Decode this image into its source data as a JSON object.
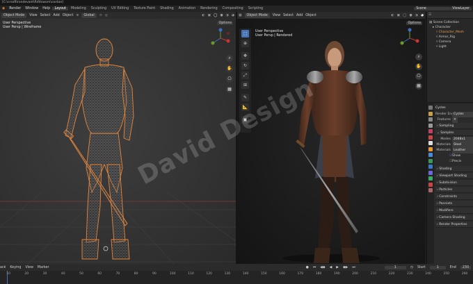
{
  "window": {
    "title": "[C:\\crsoft\\rondevant\\Rd\\tsworn\\contan]"
  },
  "menubar": {
    "items": [
      "Render",
      "Window",
      "Help"
    ],
    "workspaces": [
      "Layout",
      "Modeling",
      "Sculpting",
      "UV Editing",
      "Texture Paint",
      "Shading",
      "Animation",
      "Rendering",
      "Compositing",
      "Scripting"
    ],
    "active_workspace": "Layout",
    "scene": "Scene",
    "view_layer": "ViewLayer"
  },
  "left_viewport": {
    "mode": "Object Mode",
    "menus": [
      "View",
      "Select",
      "Add",
      "Object"
    ],
    "orientation": "Global",
    "options": "Options",
    "label_line1": "User Perspective",
    "label_line2": "User Persp | Wireframe",
    "shading": "wireframe"
  },
  "right_viewport": {
    "mode": "Object Mode",
    "menus": [
      "View",
      "Select",
      "Add",
      "Object"
    ],
    "options": "Options",
    "label_line1": "User Perspective",
    "label_line2": "User Persp | Rendered",
    "shading": "rendered"
  },
  "toolbar_tools": [
    "select-icon",
    "cursor-icon",
    "move-icon",
    "rotate-icon",
    "scale-icon",
    "transform-icon",
    "annotate-icon",
    "measure-icon",
    "add-cube-icon"
  ],
  "outliner": {
    "rows": [
      {
        "label": "Scene Collection",
        "depth": 0,
        "color": "#d0d0d0"
      },
      {
        "label": "Character",
        "depth": 1,
        "color": "#d0d0d0"
      },
      {
        "label": "Character_Mesh",
        "depth": 2,
        "color": "#e8a04a"
      },
      {
        "label": "Armor_Rig",
        "depth": 2,
        "color": "#d0d0d0"
      },
      {
        "label": "Camera",
        "depth": 2,
        "color": "#d0d0d0"
      },
      {
        "label": "Light",
        "depth": 2,
        "color": "#d0d0d0"
      }
    ]
  },
  "properties": {
    "header": "Cycles",
    "render_engine_label": "Render Engine",
    "render_engine_value": "Cycles",
    "features_label": "Features",
    "sections_top": [
      "Sampling",
      "Samples"
    ],
    "fields": [
      {
        "k": "Modes",
        "v": "2048x1"
      },
      {
        "k": "Materials",
        "v": "Steel"
      },
      {
        "k": "Materials",
        "v": "Leather"
      }
    ],
    "checkboxes": [
      "Show",
      "Precis"
    ],
    "sections": [
      "Shading",
      "Viewport Shading",
      "Subdivision",
      "Particles",
      "Constraints",
      "Panniets",
      "Modifiers",
      "Camera Shading",
      "Render Properties"
    ]
  },
  "timeline_header": {
    "items": [
      "ack",
      "Keying",
      "View",
      "Marker"
    ],
    "current_frame": "1",
    "start_label": "Start",
    "start": "1",
    "end_label": "End",
    "end": "230"
  },
  "timeline": {
    "ticks": [
      "10",
      "20",
      "30",
      "40",
      "50",
      "60",
      "70",
      "80",
      "90",
      "100",
      "110",
      "120",
      "130",
      "140",
      "150",
      "160",
      "170",
      "180",
      "190",
      "200",
      "210",
      "220",
      "230",
      "240",
      "250",
      "260"
    ]
  },
  "watermark": "David Design",
  "colors": {
    "accent": "#4772b3",
    "wire": "#e8873a",
    "active_object": "#e8a04a"
  }
}
